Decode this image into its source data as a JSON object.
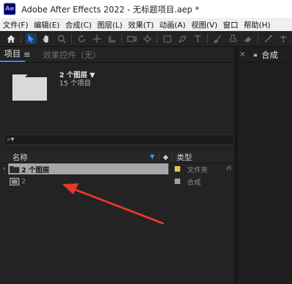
{
  "titlebar": {
    "logo": "Ae",
    "title": "Adobe After Effects 2022 - 无标题项目.aep *"
  },
  "menu": [
    "文件(F)",
    "编辑(E)",
    "合成(C)",
    "图层(L)",
    "效果(T)",
    "动画(A)",
    "视图(V)",
    "窗口",
    "帮助(H)"
  ],
  "toolbar": {
    "icons": [
      "home-icon",
      "selection-tool-icon",
      "hand-tool-icon",
      "zoom-tool-icon",
      "rotate-tool-icon",
      "move-tool-icon",
      "anchor-tool-icon",
      "camera-tool-icon",
      "mask-tool-icon",
      "pen-tool-icon",
      "type-tool-icon",
      "brush-tool-icon",
      "stamp-tool-icon",
      "eraser-tool-icon",
      "roto-tool-icon",
      "puppet-tool-icon"
    ]
  },
  "project_panel": {
    "tab_project": "项目",
    "tab_effects": "效果控件（无）",
    "selected_name": "2 个图层 ▼",
    "selected_count": "15 个项目",
    "search_placeholder": "",
    "header": {
      "name": "名称",
      "type": "类型"
    },
    "rows": [
      {
        "label": "2 个图层",
        "type": "文件夹",
        "swatch": "#d9c84a",
        "icon": "folder-icon"
      },
      {
        "label": "2",
        "type": "合成",
        "swatch": "#a8a08a",
        "icon": "composition-icon"
      }
    ]
  },
  "comp_panel": {
    "title": "合成"
  },
  "annotation": {
    "color": "#e8372a",
    "icon": "red-arrow-annotation"
  }
}
